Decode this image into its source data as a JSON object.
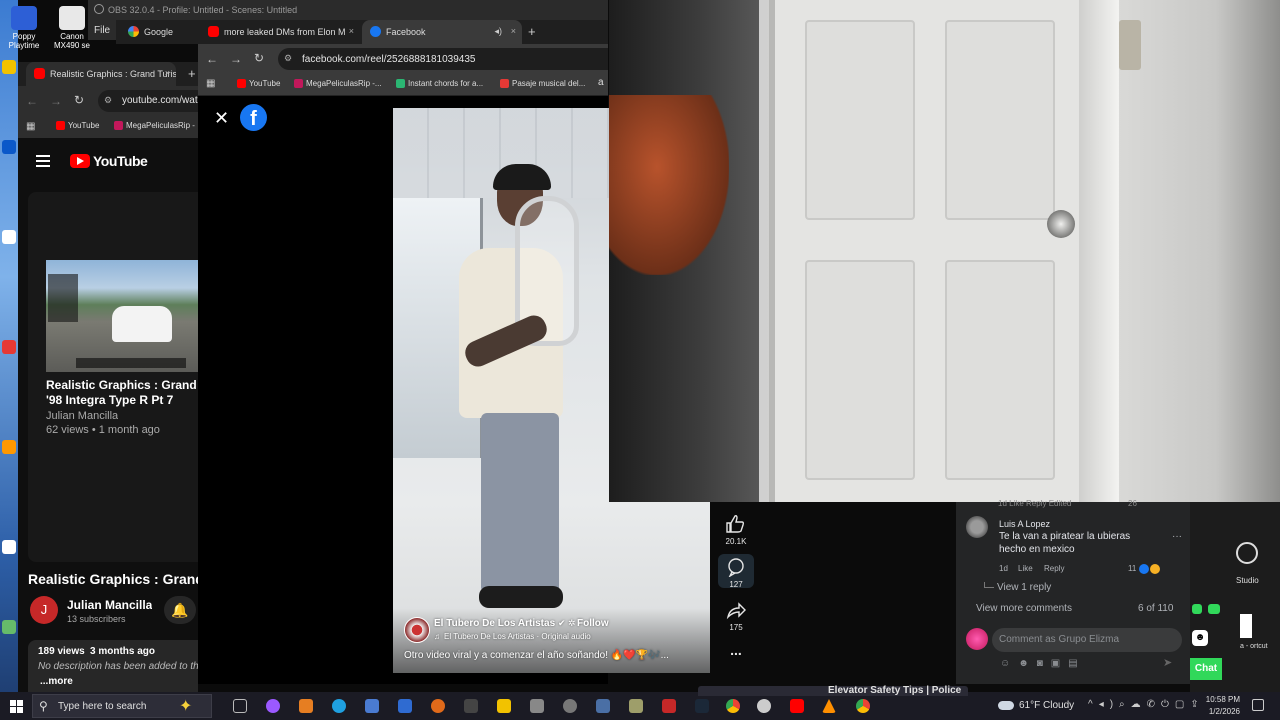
{
  "desktop": {
    "icons": [
      {
        "label": "Poppy Playtime"
      },
      {
        "label": "Canon MX490 se"
      }
    ]
  },
  "obs": {
    "title": "OBS 32.0.4 - Profile: Untitled - Scenes: Untitled",
    "menu_file": "File"
  },
  "back_browser": {
    "tabs": [
      {
        "label": "Google"
      },
      {
        "label": "more leaked DMs from Elon M"
      },
      {
        "label": "Facebook"
      }
    ],
    "new_tab": "+",
    "close": "×"
  },
  "fb_browser": {
    "url": "facebook.com/reel/2526888181039435",
    "bookmarks": [
      {
        "label": "YouTube",
        "color": "#ff0000"
      },
      {
        "label": "MegaPeliculasRip -...",
        "color": "#c2185b"
      },
      {
        "label": "Instant chords for a...",
        "color": "#2bb673"
      },
      {
        "label": "Pasaje musical del...",
        "color": "#e53935"
      }
    ],
    "bookmarks_more": "a"
  },
  "yt_browser": {
    "tab_title": "Realistic Graphics : Grand Turis",
    "tab_close": "×",
    "tab_new": "+",
    "url": "youtube.com/watc",
    "bookmarks": [
      {
        "label": "YouTube"
      },
      {
        "label": "MegaPeliculasRip -"
      }
    ],
    "logo_text": "YouTube",
    "related": {
      "title_line1": "Realistic Graphics : Grand Tu",
      "title_line2": "'98 Integra Type R Pt 7",
      "channel": "Julian Mancilla",
      "meta": "62 views • 1 month ago"
    },
    "video_title": "Realistic Graphics : Grand",
    "channel_initial": "J",
    "channel_name": "Julian Mancilla",
    "subscribers": "13 subscribers",
    "views": "189 views",
    "age": "3 months ago",
    "description": "No description has been added to th",
    "more": "...more"
  },
  "reel": {
    "author": "El Tubero De Los Artistas",
    "follow": "Follow",
    "audio": "El Tubero De Los Artistas · Original audio",
    "caption": "Otro video viral y a comenzar el año soñando! 🔥❤️🏆🎶...",
    "likes": "20.1K",
    "comments_count": "127",
    "shares": "175",
    "more": "..."
  },
  "comments": {
    "top_partial": {
      "meta": "1d   Like   Reply   Edited",
      "count": "26"
    },
    "entry": {
      "name": "Luis A Lopez",
      "text_line1": "Te la van a piratear la ubieras",
      "text_line2": "hecho en mexico",
      "time": "1d",
      "like": "Like",
      "reply": "Reply",
      "reactions": "11",
      "options": "···"
    },
    "view_reply": "View 1 reply",
    "view_more": "View more comments",
    "counter": "6 of 110",
    "input_placeholder": "Comment as Grupo Elizma"
  },
  "right_strip": {
    "label_studio": "Studio",
    "label_shortcut": "a - ortcut",
    "chat_button": "Chat"
  },
  "taskbar": {
    "search_placeholder": "Type here to search",
    "weather": "61°F  Cloudy",
    "media_title": "Elevator Safety Tips | Police",
    "time": "10:58 PM",
    "date": "1/2/2026"
  },
  "colors": {
    "facebook_blue": "#1877f2",
    "youtube_red": "#ff0000",
    "chat_green": "#31d85a"
  }
}
